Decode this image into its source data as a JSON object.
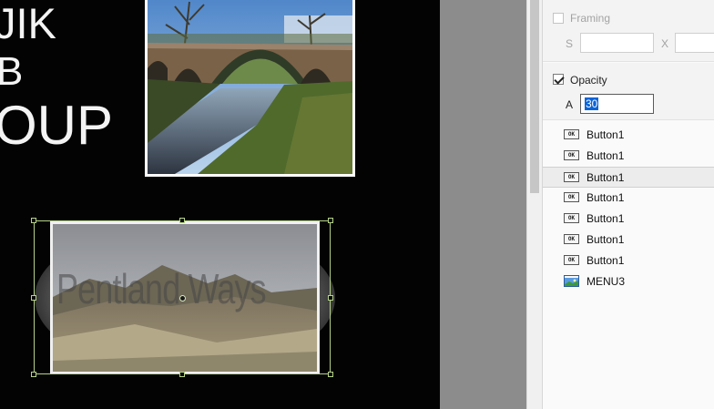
{
  "canvas": {
    "title_lines": [
      "JIK",
      "B",
      "OUP"
    ],
    "watermark_text": "Pentland Ways",
    "images": [
      "bridge-photo",
      "hills-photo"
    ]
  },
  "panel": {
    "framing": {
      "label": "Framing",
      "checked": false,
      "s_label": "S",
      "s_value": "",
      "x_label": "X",
      "x_value": ""
    },
    "opacity": {
      "label": "Opacity",
      "checked": true,
      "a_label": "A",
      "a_value": "30"
    },
    "tree": {
      "items": [
        {
          "label": "Button1",
          "icon": "ok-button-icon",
          "selected": false
        },
        {
          "label": "Button1",
          "icon": "ok-button-icon",
          "selected": false
        },
        {
          "label": "Button1",
          "icon": "ok-button-icon",
          "selected": true
        },
        {
          "label": "Button1",
          "icon": "ok-button-icon",
          "selected": false
        },
        {
          "label": "Button1",
          "icon": "ok-button-icon",
          "selected": false
        },
        {
          "label": "Button1",
          "icon": "ok-button-icon",
          "selected": false
        },
        {
          "label": "Button1",
          "icon": "ok-button-icon",
          "selected": false
        },
        {
          "label": "MENU3",
          "icon": "menu-image-icon",
          "selected": false
        }
      ],
      "ok_glyph": "OK"
    }
  },
  "colors": {
    "canvas_bg": "#030303",
    "selection": "#b6d38a",
    "text_selection": "#0a64d8"
  }
}
